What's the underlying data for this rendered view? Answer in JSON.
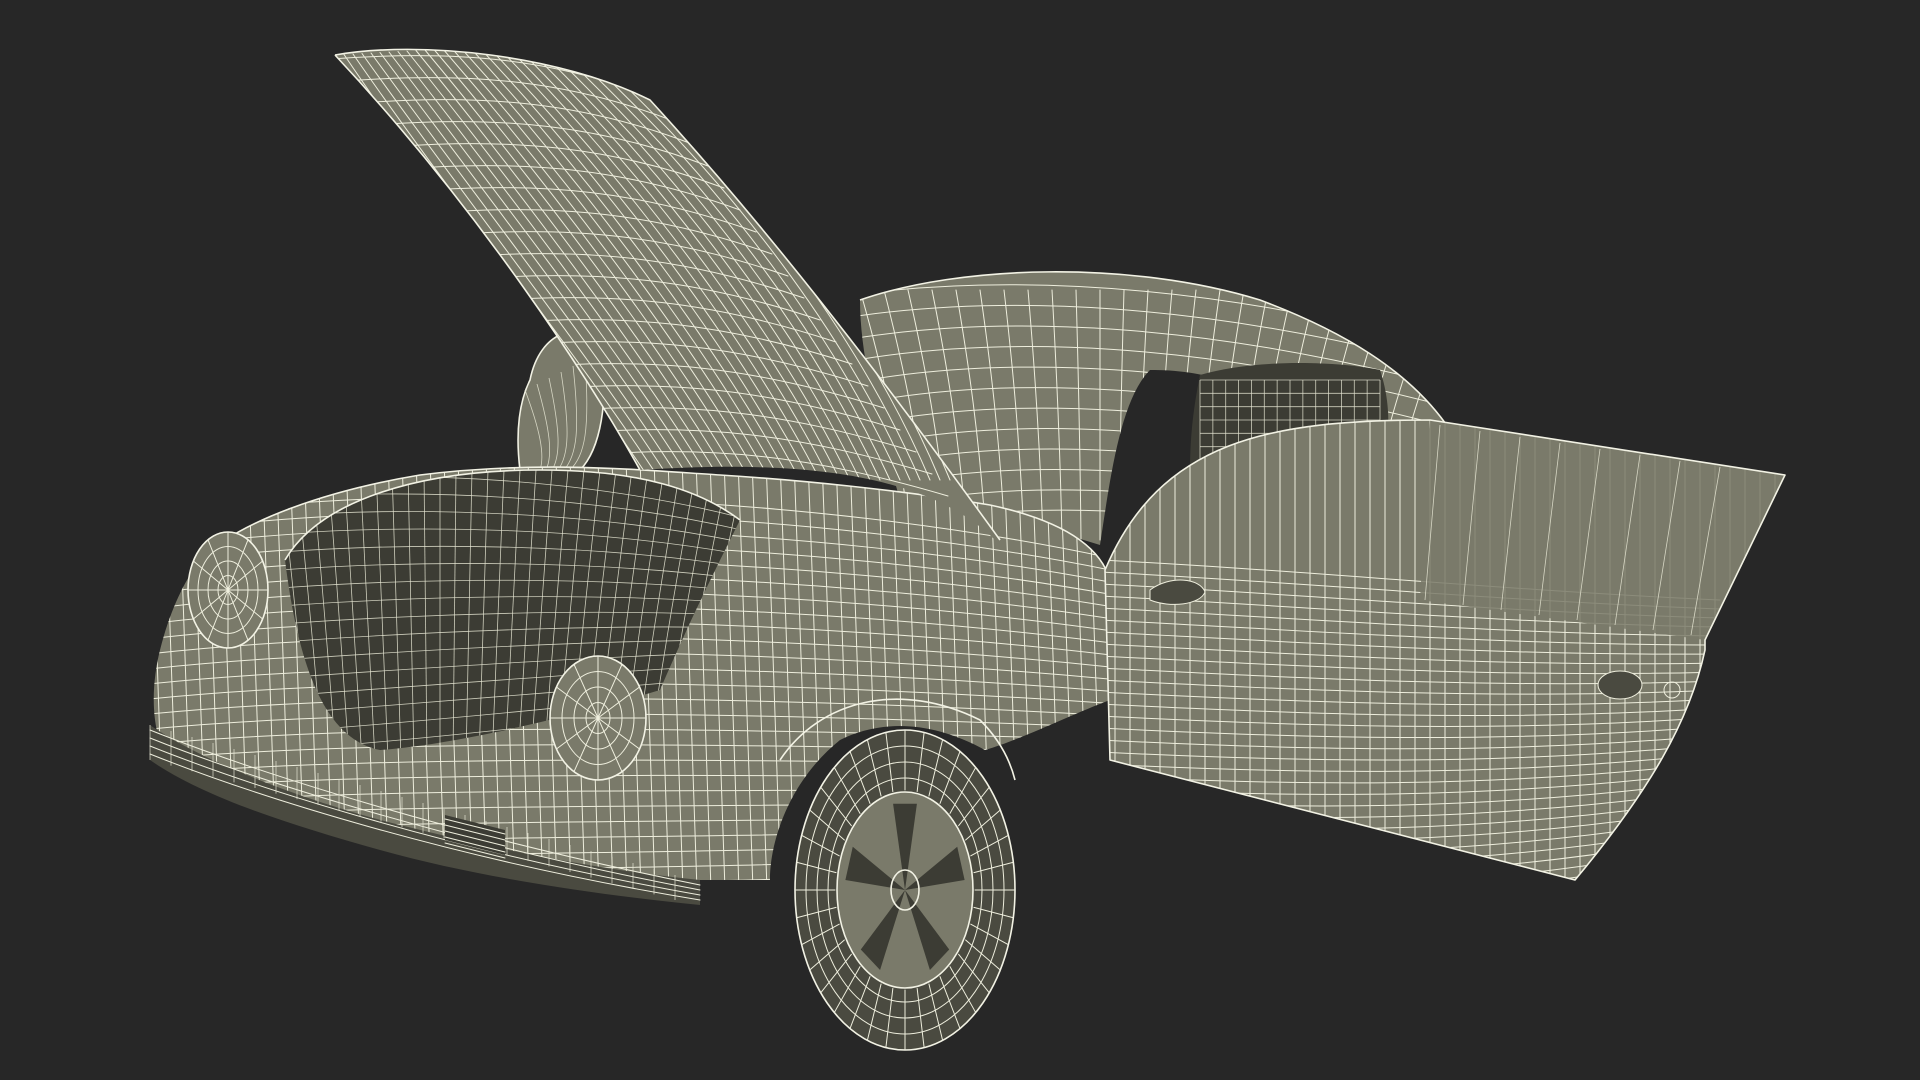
{
  "scene": {
    "background_color": "#272727",
    "surface_color": "#7a7a6a",
    "surface_dark_color": "#4a4a40",
    "interior_color": "#3c3c34",
    "wire_color": "#eeeedd",
    "subject": "wireframe-classic-coupe-hood-and-door-open"
  }
}
